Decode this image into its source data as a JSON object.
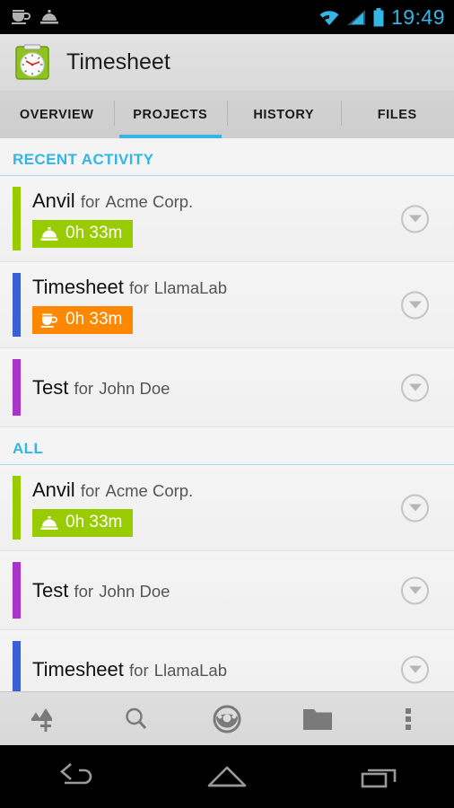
{
  "status_bar": {
    "notification_icons": [
      "coffee-cup-icon",
      "service-bell-icon"
    ],
    "system_icons": [
      "wifi-icon",
      "signal-icon",
      "battery-icon"
    ],
    "time": "19:49",
    "accent_color": "#33b5e5"
  },
  "action_bar": {
    "app_icon": "timesheet-clipboard-clock-icon",
    "title": "Timesheet"
  },
  "tabs": {
    "items": [
      {
        "label": "OVERVIEW",
        "active": false
      },
      {
        "label": "PROJECTS",
        "active": true
      },
      {
        "label": "HISTORY",
        "active": false
      },
      {
        "label": "FILES",
        "active": false
      }
    ],
    "indicator_color": "#33b5e5"
  },
  "sections": [
    {
      "title": "RECENT ACTIVITY",
      "rows": [
        {
          "project": "Anvil",
          "for_label": "for",
          "client": "Acme Corp.",
          "bar_color": "#99cc00",
          "chip": {
            "text": "0h 33m",
            "color": "#99cc00",
            "icon": "service-bell-icon"
          },
          "expander": "chevron-down-icon"
        },
        {
          "project": "Timesheet",
          "for_label": "for",
          "client": "LlamaLab",
          "bar_color": "#3b5fd4",
          "chip": {
            "text": "0h 33m",
            "color": "#ff8800",
            "icon": "coffee-cup-icon"
          },
          "expander": "chevron-down-icon"
        },
        {
          "project": "Test",
          "for_label": "for",
          "client": "John Doe",
          "bar_color": "#aa33cc",
          "chip": null,
          "expander": "chevron-down-icon"
        }
      ]
    },
    {
      "title": "ALL",
      "rows": [
        {
          "project": "Anvil",
          "for_label": "for",
          "client": "Acme Corp.",
          "bar_color": "#99cc00",
          "chip": {
            "text": "0h 33m",
            "color": "#99cc00",
            "icon": "service-bell-icon"
          },
          "expander": "chevron-down-icon"
        },
        {
          "project": "Test",
          "for_label": "for",
          "client": "John Doe",
          "bar_color": "#aa33cc",
          "chip": null,
          "expander": "chevron-down-icon"
        },
        {
          "project": "Timesheet",
          "for_label": "for",
          "client": "LlamaLab",
          "bar_color": "#3b5fd4",
          "chip": null,
          "expander": "chevron-down-icon"
        }
      ]
    }
  ],
  "bottom_bar": {
    "items": [
      {
        "icon": "add-project-icon"
      },
      {
        "icon": "search-icon"
      },
      {
        "icon": "steering-wheel-icon"
      },
      {
        "icon": "folder-icon"
      },
      {
        "icon": "overflow-menu-icon"
      }
    ]
  },
  "nav_bar": {
    "items": [
      {
        "icon": "back-icon"
      },
      {
        "icon": "home-icon"
      },
      {
        "icon": "recents-icon"
      }
    ]
  }
}
